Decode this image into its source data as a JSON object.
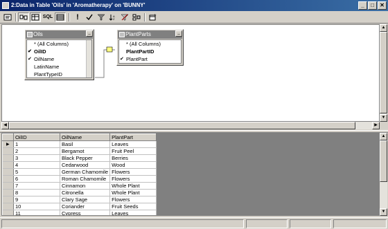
{
  "window": {
    "title": "2:Data in Table 'Oils' in 'Aromatherapy' on 'BUNNY'",
    "minimize_glyph": "_",
    "maximize_glyph": "□",
    "close_glyph": "✕"
  },
  "toolbar": {
    "sql_label": "SQL",
    "run_glyph": "!",
    "icons": [
      "diagram-pane-icon",
      "grid-pane-icon",
      "sql-pane-icon",
      "results-pane-icon",
      "run-icon",
      "verify-sql-icon",
      "filter-icon",
      "sort-icon",
      "remove-filter-icon",
      "group-by-icon",
      "add-table-icon"
    ]
  },
  "diagram": {
    "tables": [
      {
        "name": "Oils",
        "columns": [
          {
            "label": "* (All Columns)",
            "checked": false,
            "bold": false
          },
          {
            "label": "OilID",
            "checked": true,
            "bold": true
          },
          {
            "label": "OilName",
            "checked": true,
            "bold": false
          },
          {
            "label": "LatinName",
            "checked": false,
            "bold": false
          },
          {
            "label": "PlantTypeID",
            "checked": false,
            "bold": false
          }
        ]
      },
      {
        "name": "PlantParts",
        "columns": [
          {
            "label": "* (All Columns)",
            "checked": false,
            "bold": false
          },
          {
            "label": "PlantPartID",
            "checked": false,
            "bold": true
          },
          {
            "label": "PlantPart",
            "checked": true,
            "bold": false
          }
        ]
      }
    ]
  },
  "grid": {
    "headers": [
      "OilID",
      "OilName",
      "PlantPart"
    ],
    "rows": [
      [
        "1",
        "Basil",
        "Leaves"
      ],
      [
        "2",
        "Bergamot",
        "Fruit Peel"
      ],
      [
        "3",
        "Black Pepper",
        "Berries"
      ],
      [
        "4",
        "Cedarwood",
        "Wood"
      ],
      [
        "5",
        "German Chamomile",
        "Flowers"
      ],
      [
        "6",
        "Roman Chamomile",
        "Flowers"
      ],
      [
        "7",
        "Cinnamon",
        "Whole Plant"
      ],
      [
        "8",
        "Citronella",
        "Whole Plant"
      ],
      [
        "9",
        "Clary Sage",
        "Flowers"
      ],
      [
        "10",
        "Coriander",
        "Fruit Seeds"
      ],
      [
        "11",
        "Cypress",
        "Leaves"
      ]
    ],
    "current_row_glyph": "▶"
  },
  "colors": {
    "title_gradient_start": "#0a246a",
    "title_gradient_end": "#3a6ea5",
    "chrome": "#d4d0c8",
    "table_header": "#808080"
  }
}
